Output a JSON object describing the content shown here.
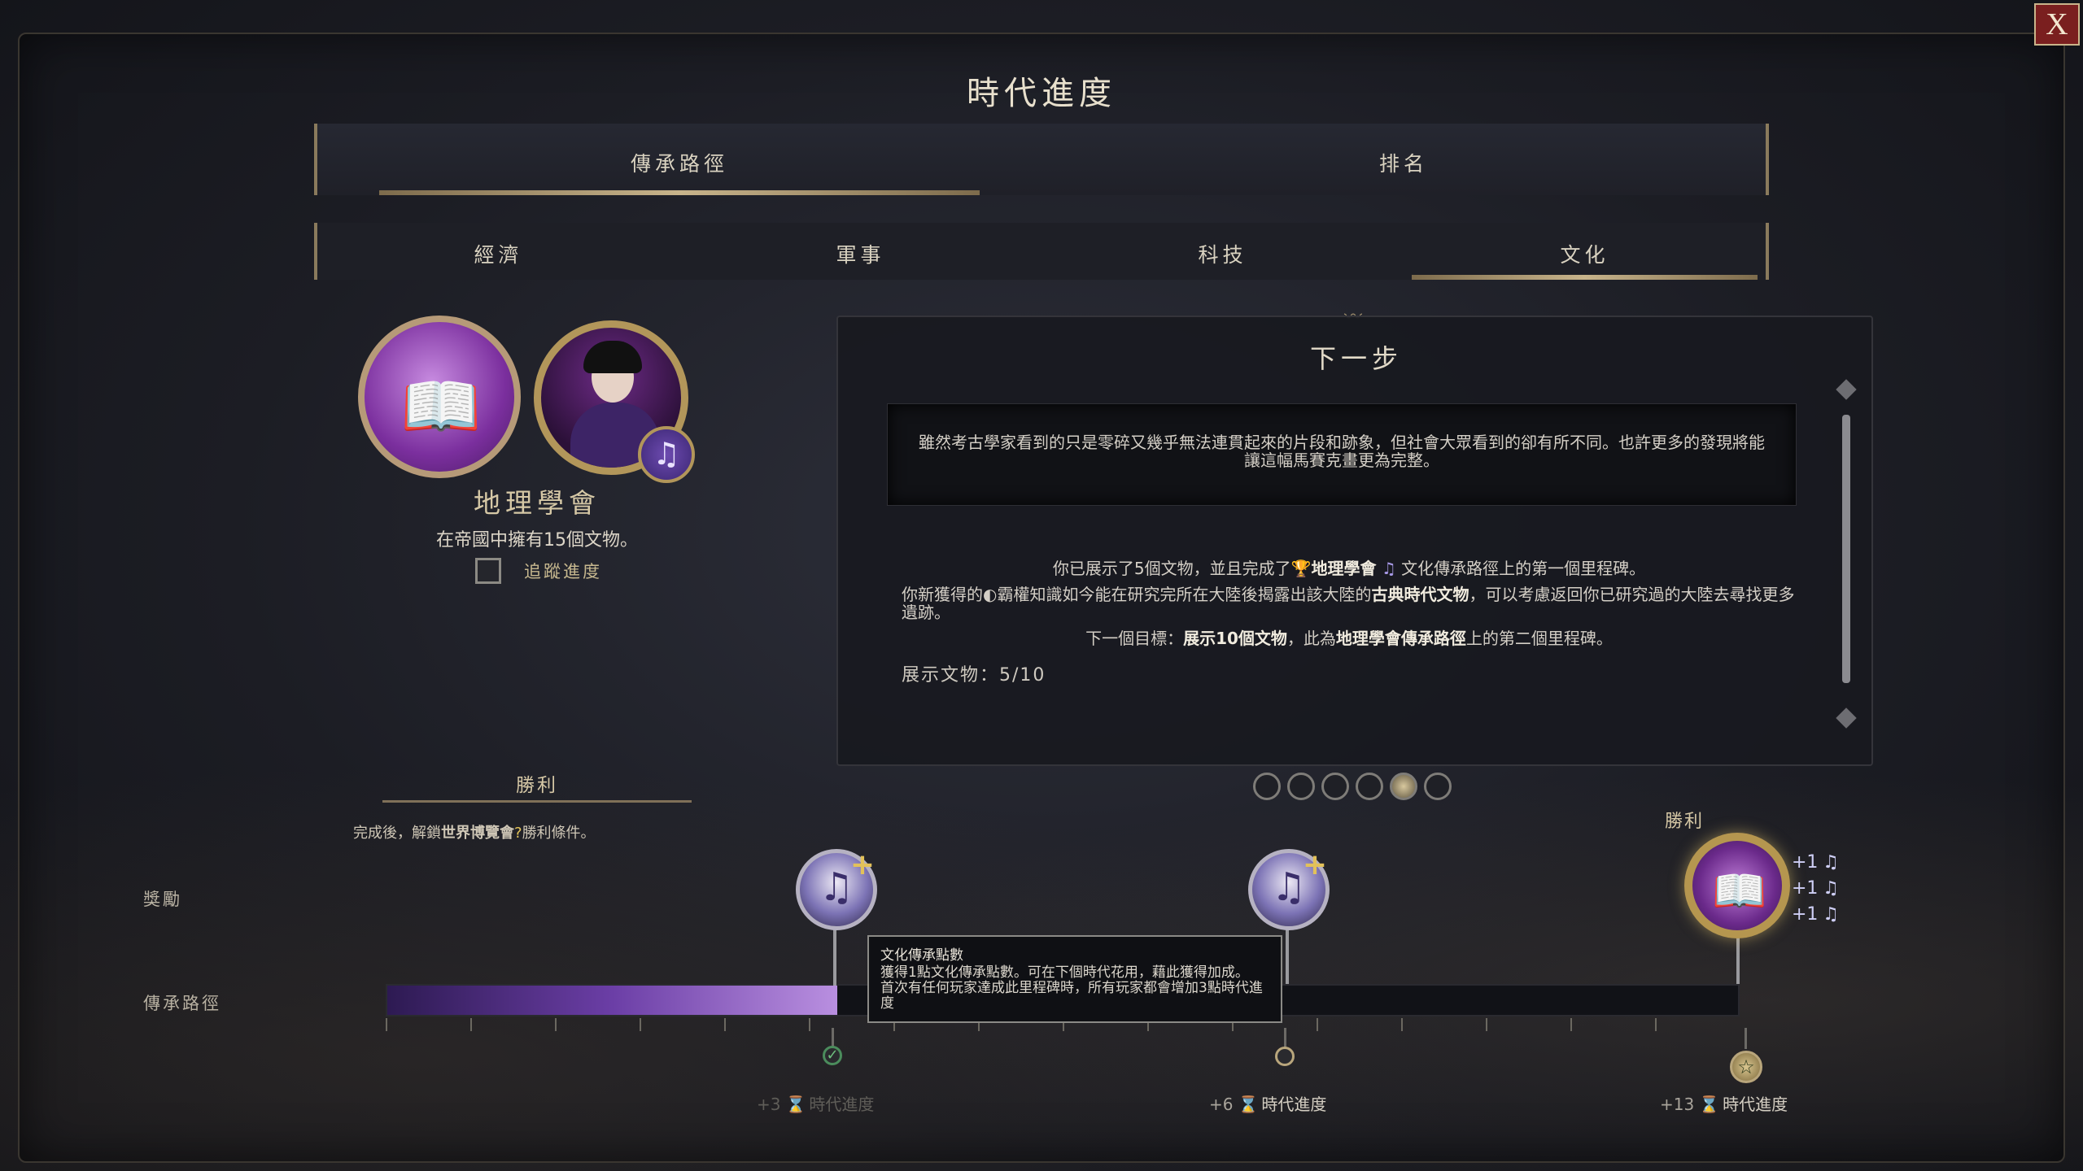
{
  "window": {
    "title": "時代進度",
    "close_label": "X"
  },
  "main_tabs": [
    {
      "label": "傳承路徑",
      "active": true
    },
    {
      "label": "排名",
      "active": false
    }
  ],
  "sub_tabs": [
    {
      "label": "經濟",
      "active": false
    },
    {
      "label": "軍事",
      "active": false
    },
    {
      "label": "科技",
      "active": false
    },
    {
      "label": "文化",
      "active": true
    }
  ],
  "legacy": {
    "name": "地理學會",
    "description": "在帝國中擁有15個文物。",
    "track_label": "追蹤進度",
    "track_checked": false
  },
  "next_step": {
    "title": "下一步",
    "quote": "雖然考古學家看到的只是零碎又幾乎無法連貫起來的片段和跡象，但社會大眾看到的卻有所不同。也許更多的發現將能讓這幅馬賽克畫更為完整。",
    "line1_a": "你已展示了5個文物，並且完成了",
    "line1_b": "地理學會",
    "line1_c": "文化傳承路徑上的第一個里程碑。",
    "line2_a": "你新獲得的",
    "line2_b": "霸權知識如今能在研究完所在大陸後揭露出該大陸的",
    "line2_c": "古典時代文物",
    "line2_d": "，可以考慮返回你已研究過的大陸去尋找更多遺跡。",
    "line3_a": "下一個目標：",
    "line3_b": "展示10個文物",
    "line3_c": "，此為",
    "line3_d": "地理學會傳承路徑",
    "line3_e": "上的第二個里程碑。",
    "progress": "展示文物：5/10"
  },
  "pager": {
    "count": 6,
    "active_index": 4
  },
  "victory_left": {
    "label": "勝利",
    "desc_a": "完成後，解鎖",
    "desc_b": "世界博覽會",
    "desc_icon": "?",
    "desc_c": "勝利條件。"
  },
  "rows": {
    "reward_label": "獎勵",
    "path_label": "傳承路徑"
  },
  "track": {
    "fill_fraction": 0.333,
    "tick_count": 16
  },
  "milestones": [
    {
      "bonus": "+3",
      "label": "時代進度",
      "hourglass": "⌛",
      "reached": true
    },
    {
      "bonus": "+6",
      "label": "時代進度",
      "hourglass": "⌛",
      "reached": false
    },
    {
      "bonus": "+13",
      "label": "時代進度",
      "hourglass": "⌛",
      "reached": false
    }
  ],
  "victory_right": {
    "label": "勝利"
  },
  "final_bonus": [
    {
      "text": "+1",
      "icon": "♫"
    },
    {
      "text": "+1",
      "icon": "♫"
    },
    {
      "text": "+1",
      "icon": "♫"
    }
  ],
  "tooltip": {
    "title": "文化傳承點數",
    "line1": "獲得1點文化傳承點數。可在下個時代花用，藉此獲得加成。",
    "line2": "首次有任何玩家達成此里程碑時，所有玩家都會增加3點時代進度"
  },
  "icons": {
    "reward": "music-note-icon",
    "legacy": "book-icon",
    "final": "book-icon",
    "close": "close-icon"
  },
  "colors": {
    "accent_gold": "#c8b48b",
    "progress_purple": "#6b3ea6",
    "close_red": "#7a1f1f"
  }
}
